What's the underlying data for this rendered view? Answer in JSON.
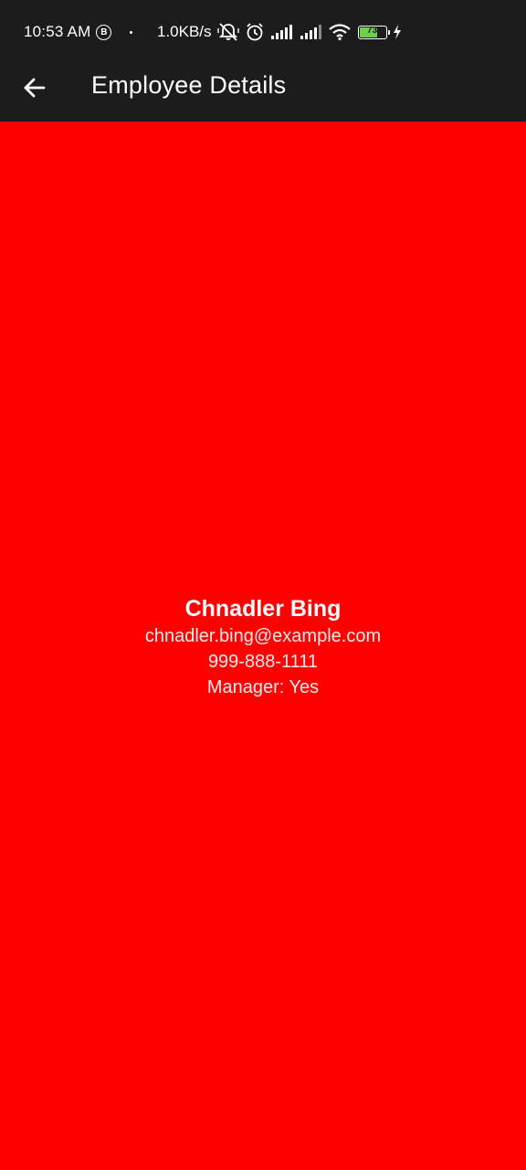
{
  "status_bar": {
    "time": "10:53 AM",
    "badge": "B",
    "net_speed": "1.0KB/s",
    "battery_level": "73",
    "battery_fraction": 0.73,
    "icons": [
      "b-circle-icon",
      "notification-dot",
      "mute-vibrate-icon",
      "alarm-icon",
      "signal-icon",
      "signal-icon",
      "wifi-icon",
      "battery-icon",
      "charging-bolt-icon"
    ],
    "battery_color": "#6ed04a"
  },
  "app_bar": {
    "title": "Employee Details",
    "back_icon": "arrow-left-icon",
    "background": "#1c1c1c"
  },
  "employee": {
    "name": "Chnadler Bing",
    "email": "chnadler.bing@example.com",
    "phone": "999-888-1111",
    "manager": "Manager: Yes"
  },
  "theme": {
    "content_background": "#ff0000",
    "text_color": "#ffffff"
  }
}
